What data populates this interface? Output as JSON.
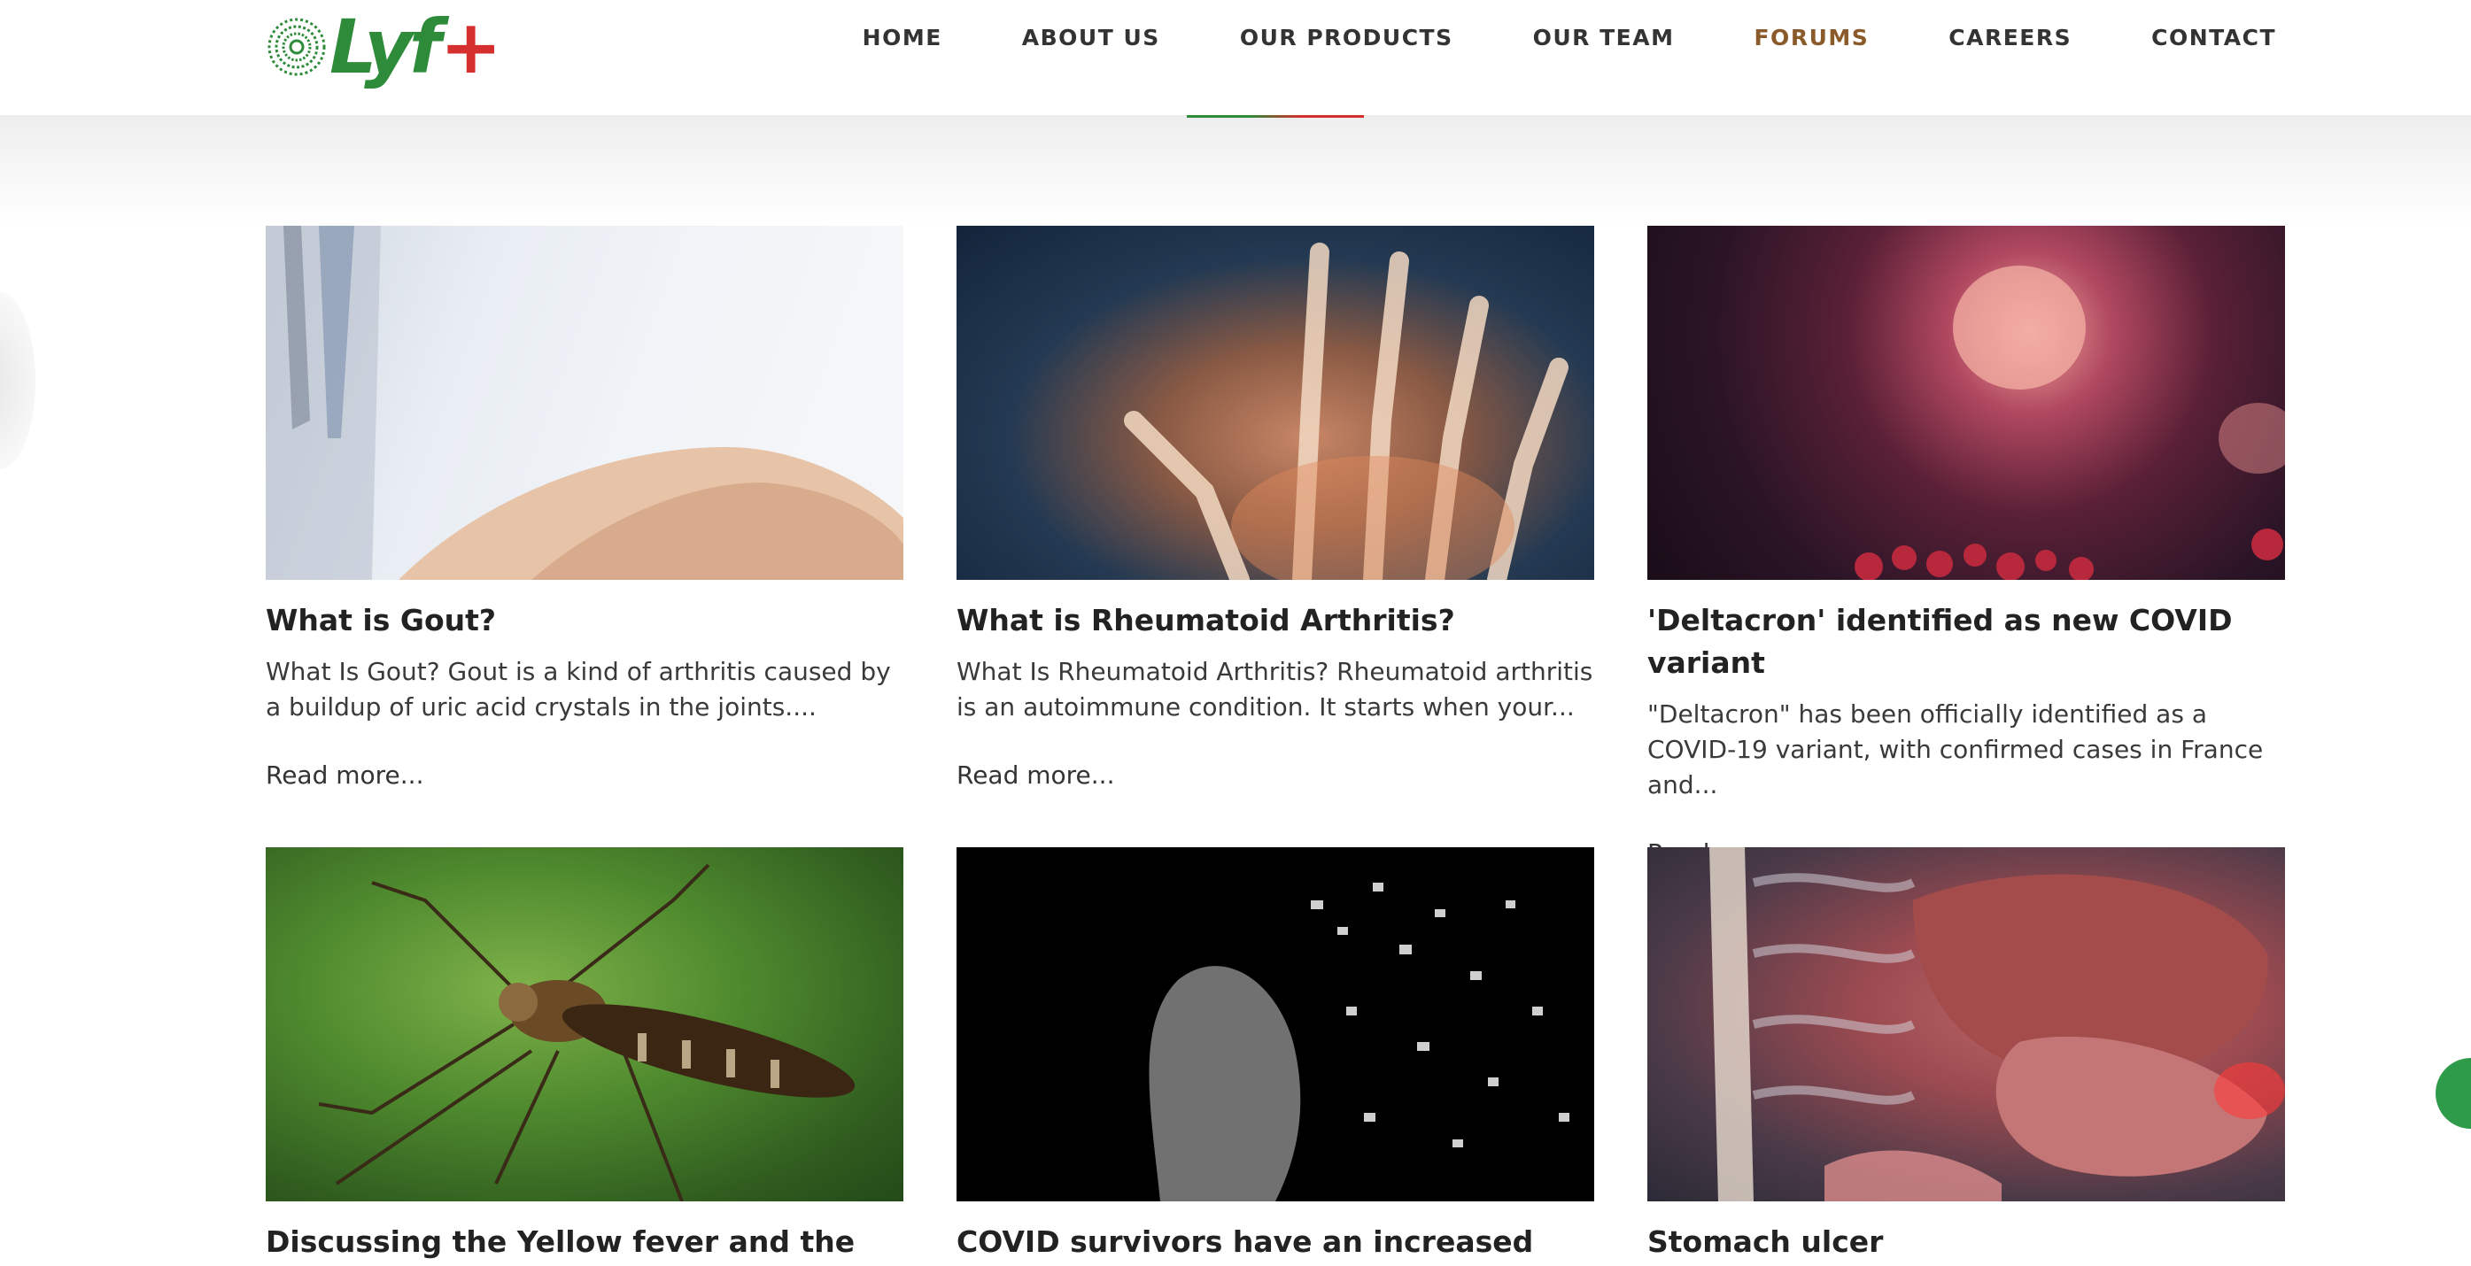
{
  "brand": {
    "name": "Lyf",
    "plus": "+",
    "colors": {
      "green": "#2e8b3a",
      "red": "#d62f2f",
      "active_nav": "#8b5a2b"
    }
  },
  "nav": {
    "items": [
      {
        "label": "HOME",
        "active": false
      },
      {
        "label": "ABOUT US",
        "active": false
      },
      {
        "label": "OUR PRODUCTS",
        "active": false
      },
      {
        "label": "OUR TEAM",
        "active": false
      },
      {
        "label": "FORUMS",
        "active": true
      },
      {
        "label": "CAREERS",
        "active": false
      },
      {
        "label": "CONTACT",
        "active": false
      }
    ]
  },
  "posts": [
    {
      "title": "What is Gout?",
      "excerpt": "What Is Gout? Gout is a kind of arthritis caused by a buildup of uric acid crystals in the joints....",
      "read_more": "Read more..."
    },
    {
      "title": "What is Rheumatoid Arthritis?",
      "excerpt": "What Is Rheumatoid Arthritis? Rheumatoid arthritis is an autoimmune condition. It starts when your...",
      "read_more": "Read more..."
    },
    {
      "title": "'Deltacron' identified as new COVID variant",
      "excerpt": "\"Deltacron\" has been officially identified as a COVID-19 variant, with confirmed cases in France and...",
      "read_more": "Read more..."
    },
    {
      "title": "Discussing the Yellow fever and the recent"
    },
    {
      "title": "COVID survivors have an increased risk of"
    },
    {
      "title": "Stomach ulcer"
    }
  ]
}
